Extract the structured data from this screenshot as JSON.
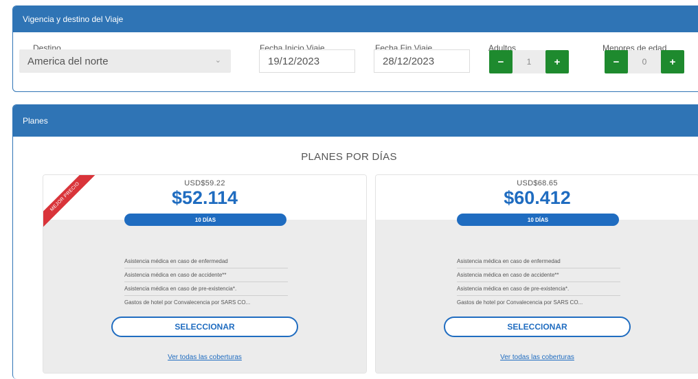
{
  "trip": {
    "header": "Vigencia y destino del Viaje",
    "destination": {
      "label": "Destino",
      "value": "America del norte"
    },
    "start_date": {
      "label": "Fecha Inicio Viaje",
      "value": "19/12/2023"
    },
    "end_date": {
      "label": "Fecha Fin Viaje",
      "value": "28/12/2023"
    },
    "adults": {
      "label": "Adultos",
      "value": "1",
      "minus": "−",
      "plus": "+"
    },
    "minors": {
      "label": "Menores de edad",
      "value": "0",
      "minus": "−",
      "plus": "+"
    }
  },
  "plans": {
    "header": "Planes",
    "section_title": "PLANES POR DÍAS",
    "cards": [
      {
        "ribbon": "MEJOR PRECIO",
        "usd": "USD$59.22",
        "price": "$52.114",
        "days": "10 DÍAS",
        "benefits": [
          "Asistencia médica en caso de enfermedad",
          "Asistencia médica en caso de accidente**",
          "Asistencia médica en caso de pre-existencia*.",
          "Gastos de hotel por Convalecencia por SARS CO..."
        ],
        "select": "SELECCIONAR",
        "coverage": "Ver todas las coberturas"
      },
      {
        "usd": "USD$68.65",
        "price": "$60.412",
        "days": "10 DÍAS",
        "benefits": [
          "Asistencia médica en caso de enfermedad",
          "Asistencia médica en caso de accidente**",
          "Asistencia médica en caso de pre-existencia*.",
          "Gastos de hotel por Convalecencia por SARS CO..."
        ],
        "select": "SELECCIONAR",
        "coverage": "Ver todas las coberturas"
      }
    ]
  },
  "colors": {
    "primary": "#2f74b5",
    "price": "#1f6cc0",
    "stepper": "#1e8a2e",
    "ribbon": "#d9343a"
  }
}
